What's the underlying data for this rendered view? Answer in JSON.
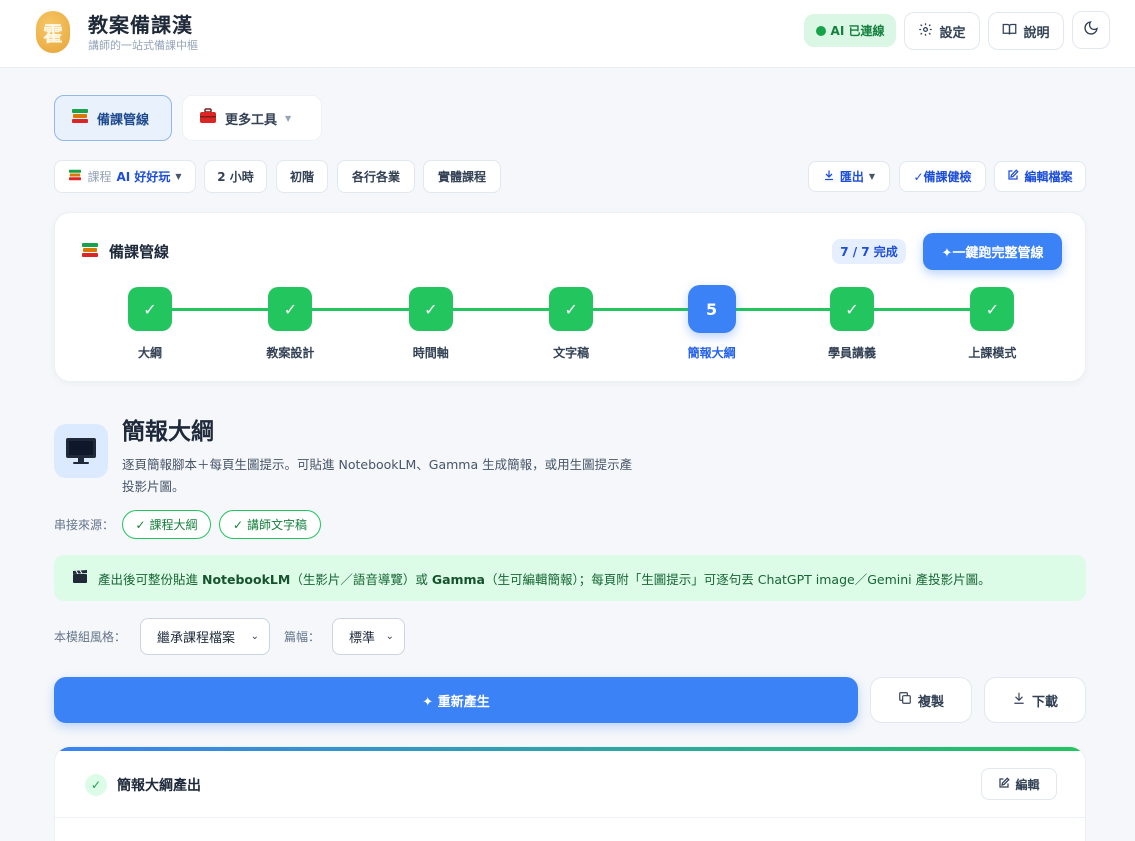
{
  "app": {
    "logo_glyph": "霍",
    "title": "教案備課漢",
    "subtitle": "講師的一站式備課中樞"
  },
  "header": {
    "ai_status": "AI 已連線",
    "ai_status_color": "#16a34a",
    "settings_label": "設定",
    "help_label": "說明",
    "theme_icon": "moon-icon"
  },
  "tabs": {
    "pipeline_label": "備課管線",
    "more_tools_label": "更多工具"
  },
  "course": {
    "course_label": "課程",
    "course_value": "AI 好好玩",
    "duration": "2 小時",
    "level": "初階",
    "audience": "各行各業",
    "format": "實體課程"
  },
  "actions": {
    "export_label": "匯出",
    "check_label": "✓備課健檢",
    "edit_file_label": "編輯檔案"
  },
  "pipeline": {
    "title": "備課管線",
    "progress": "7 / 7 完成",
    "run_all_label": "✦一鍵跑完整管線",
    "accent_color": "#22c55e",
    "current_color": "#3b82f6",
    "steps": [
      {
        "label": "大綱",
        "mark": "✓",
        "done": true
      },
      {
        "label": "教案設計",
        "mark": "✓",
        "done": true
      },
      {
        "label": "時間軸",
        "mark": "✓",
        "done": true
      },
      {
        "label": "文字稿",
        "mark": "✓",
        "done": true
      },
      {
        "label": "簡報大綱",
        "mark": "5",
        "done": false
      },
      {
        "label": "學員講義",
        "mark": "✓",
        "done": true
      },
      {
        "label": "上課模式",
        "mark": "✓",
        "done": true
      }
    ]
  },
  "module": {
    "icon": "monitor-icon",
    "title": "簡報大綱",
    "description": "逐頁簡報腳本＋每頁生圖提示。可貼進 NotebookLM、Gamma 生成簡報，或用生圖提示產投影片圖。",
    "source_label": "串接來源：",
    "sources": [
      "課程大綱",
      "講師文字稿"
    ],
    "note_prefix": "產出後可整份貼進 ",
    "note_b1": "NotebookLM",
    "note_mid": "（生影片／語音導覽）或 ",
    "note_b2": "Gamma",
    "note_suffix": "（生可編輯簡報）；每頁附「生圖提示」可逐句丟 ChatGPT image／Gemini 產投影片圖。",
    "style_label": "本模組風格：",
    "style_value": "繼承課程檔案",
    "length_label": "篇幅：",
    "length_value": "標準",
    "regen_label": "✦ 重新產生",
    "copy_label": "複製",
    "download_label": "下載"
  },
  "output": {
    "title": "簡報大綱產出",
    "edit_label": "編輯"
  }
}
